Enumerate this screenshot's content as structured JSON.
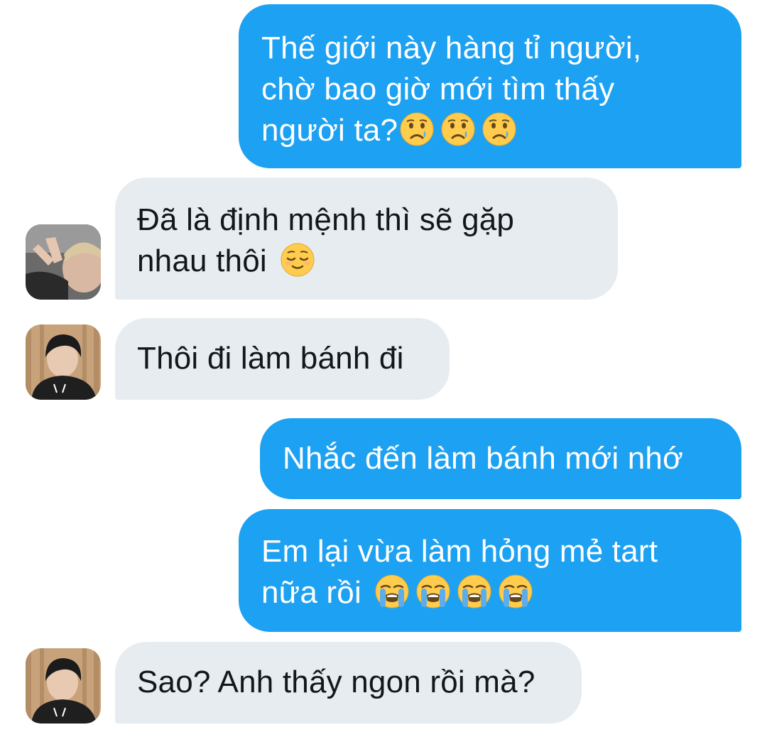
{
  "conversation": {
    "messages": [
      {
        "side": "sent",
        "lines": [
          "Thế giới này hàng tỉ người,",
          "chờ bao giờ mới tìm thấy",
          "người ta?"
        ],
        "emoji": [
          "crying-face-emoji",
          "crying-face-emoji",
          "crying-face-emoji"
        ]
      },
      {
        "side": "received",
        "lines": [
          "Đã là định mệnh thì sẽ gặp",
          "nhau thôi"
        ],
        "emoji": [
          "relieved-face-emoji"
        ]
      },
      {
        "side": "received",
        "lines": [
          "Thôi đi làm bánh đi"
        ]
      },
      {
        "side": "sent",
        "lines": [
          "Nhắc đến làm bánh mới nhớ"
        ]
      },
      {
        "side": "sent",
        "lines": [
          "Em lại vừa làm hỏng mẻ tart",
          "nữa rồi"
        ],
        "emoji": [
          "loudly-crying-face-emoji",
          "loudly-crying-face-emoji",
          "loudly-crying-face-emoji",
          "loudly-crying-face-emoji"
        ]
      },
      {
        "side": "received",
        "lines": [
          "Sao? Anh thấy ngon rồi mà?"
        ]
      }
    ]
  },
  "colors": {
    "sent_bubble": "#1da1f2",
    "received_bubble": "#e6ecf0",
    "sent_text": "#ffffff",
    "received_text": "#14171a",
    "background": "#ffffff"
  }
}
